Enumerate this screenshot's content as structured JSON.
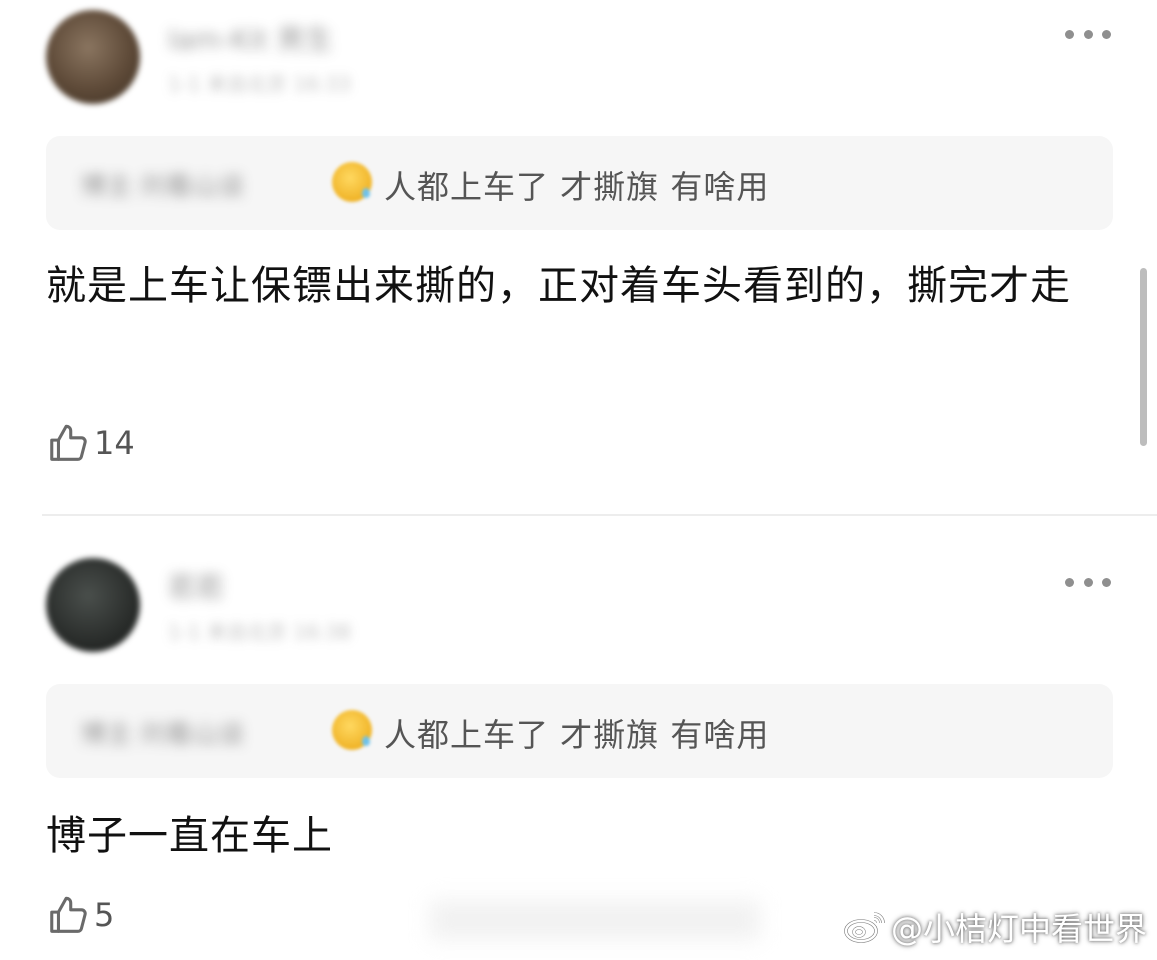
{
  "comments": [
    {
      "user_name": "Iam-Kit 男生",
      "user_meta": "1-1 来自北京 16:33",
      "quote": {
        "author": "博主·刘看山谈",
        "text": "人都上车了 才撕旗 有啥用"
      },
      "body": "就是上车让保镖出来撕的，正对着车头看到的，撕完才走",
      "likes": "14"
    },
    {
      "user_name": "若若",
      "user_meta": "1-1 来自北京 16:38",
      "quote": {
        "author": "博主·刘看山谈",
        "text": "人都上车了 才撕旗 有啥用"
      },
      "body": "博子一直在车上",
      "likes": "5"
    }
  ],
  "watermark": {
    "text": "@小桔灯中看世界"
  },
  "colors": {
    "quote_bg": "#f6f6f6",
    "body_text": "#111111",
    "muted_text": "#555555"
  },
  "icons": {
    "like": "thumbs-up-icon",
    "more": "more-dots-icon",
    "watermark": "weibo-logo-icon"
  }
}
